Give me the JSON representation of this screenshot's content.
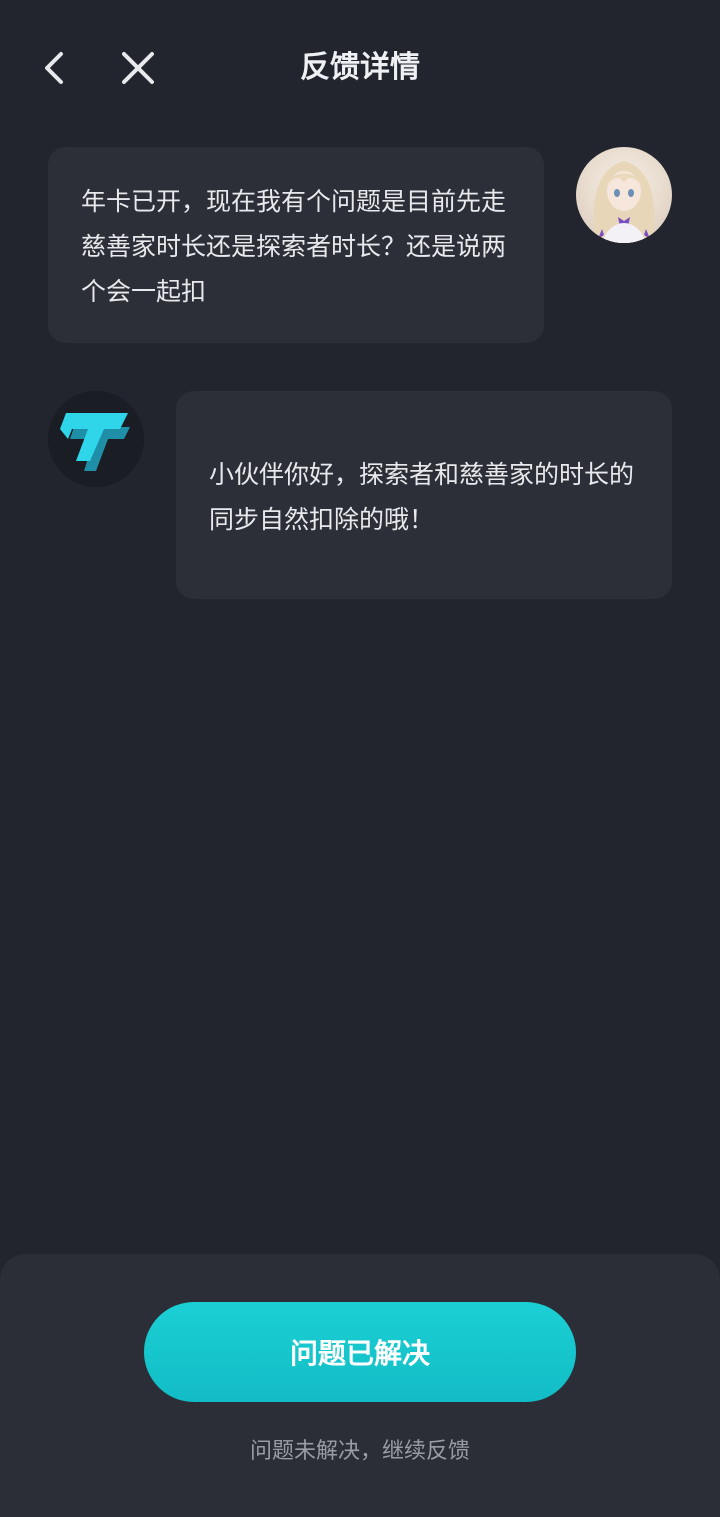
{
  "header": {
    "title": "反馈详情",
    "back_icon": "chevron-left-icon",
    "close_icon": "close-icon"
  },
  "messages": [
    {
      "sender": "user",
      "text": "年卡已开，现在我有个问题是目前先走慈善家时长还是探索者时长？还是说两个会一起扣"
    },
    {
      "sender": "agent",
      "text": "小伙伴你好，探索者和慈善家的时长的同步自然扣除的哦！"
    }
  ],
  "footer": {
    "resolved_label": "问题已解决",
    "continue_label": "问题未解决，继续反馈"
  },
  "colors": {
    "background": "#22252e",
    "bubble": "#2c2f38",
    "accent": "#15c6cd",
    "secondary_text": "#9a9ca3"
  }
}
